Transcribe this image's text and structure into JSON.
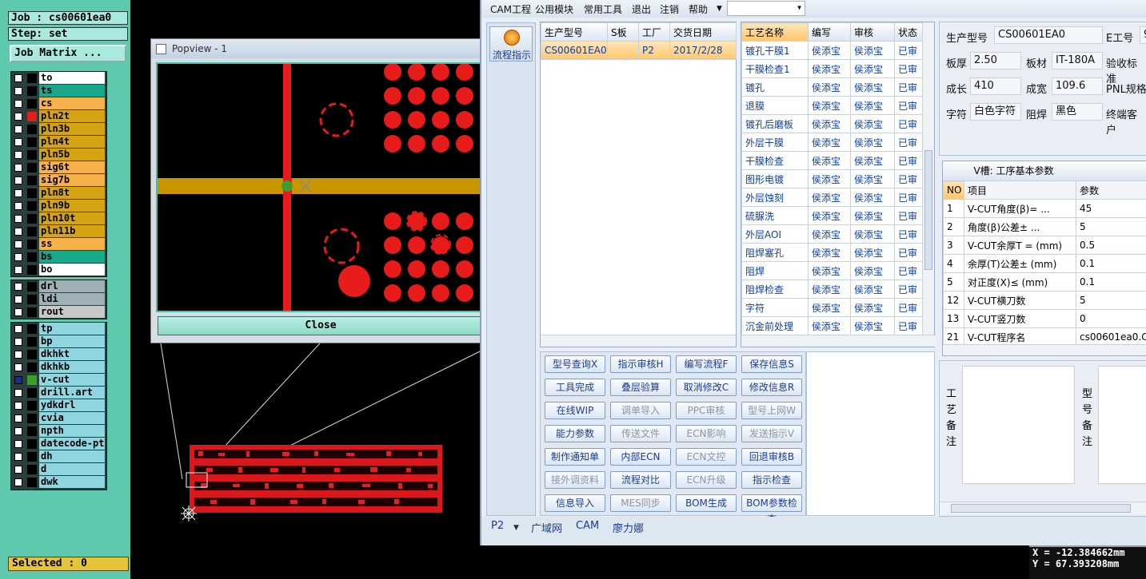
{
  "cam": {
    "job": "Job : cs00601ea0",
    "step": "Step: set",
    "job_matrix": "Job Matrix ...",
    "groups": [
      [
        {
          "name": "to",
          "bg": "#ffffff",
          "sq": "#000000",
          "cb": false
        },
        {
          "name": "ts",
          "bg": "#1aa88a",
          "sq": "#000000",
          "cb": false
        },
        {
          "name": "cs",
          "bg": "#f6b14a",
          "sq": "#000000",
          "cb": false
        },
        {
          "name": "pln2t",
          "bg": "#d4a413",
          "sq": "#e0201d",
          "cb": false
        },
        {
          "name": "pln3b",
          "bg": "#d4a413",
          "sq": "#000000",
          "cb": false
        },
        {
          "name": "pln4t",
          "bg": "#d4a413",
          "sq": "#000000",
          "cb": false
        },
        {
          "name": "pln5b",
          "bg": "#d4a413",
          "sq": "#000000",
          "cb": false
        },
        {
          "name": "sig6t",
          "bg": "#f6b14a",
          "sq": "#000000",
          "cb": false
        },
        {
          "name": "sig7b",
          "bg": "#f6b14a",
          "sq": "#000000",
          "cb": false
        },
        {
          "name": "pln8t",
          "bg": "#d4a413",
          "sq": "#000000",
          "cb": false
        },
        {
          "name": "pln9b",
          "bg": "#d4a413",
          "sq": "#000000",
          "cb": false
        },
        {
          "name": "pln10t",
          "bg": "#d4a413",
          "sq": "#000000",
          "cb": false
        },
        {
          "name": "pln11b",
          "bg": "#d4a413",
          "sq": "#000000",
          "cb": false
        },
        {
          "name": "ss",
          "bg": "#f6b14a",
          "sq": "#000000",
          "cb": false
        },
        {
          "name": "bs",
          "bg": "#1aa88a",
          "sq": "#000000",
          "cb": false
        },
        {
          "name": "bo",
          "bg": "#ffffff",
          "sq": "#000000",
          "cb": false
        }
      ],
      [
        {
          "name": "drl",
          "bg": "#9fb0b6",
          "sq": "#000000",
          "cb": false
        },
        {
          "name": "ldi",
          "bg": "#9fb0b6",
          "sq": "#000000",
          "cb": false
        },
        {
          "name": "rout",
          "bg": "#c8c8c8",
          "sq": "#000000",
          "cb": false
        }
      ],
      [
        {
          "name": "tp",
          "bg": "#8fd6e0",
          "sq": "#000000",
          "cb": false
        },
        {
          "name": "bp",
          "bg": "#8fd6e0",
          "sq": "#000000",
          "cb": false
        },
        {
          "name": "dkhkt",
          "bg": "#8fd6e0",
          "sq": "#000000",
          "cb": false
        },
        {
          "name": "dkhkb",
          "bg": "#8fd6e0",
          "sq": "#000000",
          "cb": false
        },
        {
          "name": "v-cut",
          "bg": "#8fd6e0",
          "sq": "#3aa02a",
          "cb": true
        },
        {
          "name": "drill.art",
          "bg": "#8fd6e0",
          "sq": "#000000",
          "cb": false
        },
        {
          "name": "ydkdrl",
          "bg": "#8fd6e0",
          "sq": "#000000",
          "cb": false
        },
        {
          "name": "cvia",
          "bg": "#8fd6e0",
          "sq": "#000000",
          "cb": false
        },
        {
          "name": "npth",
          "bg": "#8fd6e0",
          "sq": "#000000",
          "cb": false
        },
        {
          "name": "datecode-pte",
          "bg": "#8fd6e0",
          "sq": "#000000",
          "cb": false
        },
        {
          "name": "dh",
          "bg": "#8fd6e0",
          "sq": "#000000",
          "cb": false
        },
        {
          "name": "d",
          "bg": "#8fd6e0",
          "sq": "#000000",
          "cb": false
        },
        {
          "name": "dwk",
          "bg": "#8fd6e0",
          "sq": "#000000",
          "cb": false
        }
      ]
    ],
    "selected": "Selected : 0",
    "coord_x": "X = -12.384662mm",
    "coord_y": "Y = 67.393208mm"
  },
  "popview": {
    "title": "Popview - 1",
    "close": "Close"
  },
  "app": {
    "menu": [
      "CAM工程",
      "公用模块",
      "常用工具",
      "退出",
      "注销",
      "帮助"
    ],
    "side_button": "流程指示",
    "orders": {
      "headers": [
        "生产型号",
        "S板",
        "工厂",
        "交货日期"
      ],
      "rows": [
        [
          "CS00601EA0",
          "",
          "P2",
          "2017/2/28"
        ]
      ]
    },
    "process": {
      "headers": [
        "工艺名称",
        "编写",
        "审核",
        "状态"
      ],
      "rows": [
        [
          "镀孔干膜1",
          "侯添宝",
          "侯添宝",
          "已审"
        ],
        [
          "干膜检查1",
          "侯添宝",
          "侯添宝",
          "已审"
        ],
        [
          "镀孔",
          "侯添宝",
          "侯添宝",
          "已审"
        ],
        [
          "退膜",
          "侯添宝",
          "侯添宝",
          "已审"
        ],
        [
          "镀孔后磨板",
          "侯添宝",
          "侯添宝",
          "已审"
        ],
        [
          "外层干膜",
          "侯添宝",
          "侯添宝",
          "已审"
        ],
        [
          "干膜检查",
          "侯添宝",
          "侯添宝",
          "已审"
        ],
        [
          "图形电镀",
          "侯添宝",
          "侯添宝",
          "已审"
        ],
        [
          "外层蚀刻",
          "侯添宝",
          "侯添宝",
          "已审"
        ],
        [
          "硫脲洗",
          "侯添宝",
          "侯添宝",
          "已审"
        ],
        [
          "外层AOI",
          "侯添宝",
          "侯添宝",
          "已审"
        ],
        [
          "阻焊塞孔",
          "侯添宝",
          "侯添宝",
          "已审"
        ],
        [
          "阻焊",
          "侯添宝",
          "侯添宝",
          "已审"
        ],
        [
          "阻焊检查",
          "侯添宝",
          "侯添宝",
          "已审"
        ],
        [
          "字符",
          "侯添宝",
          "侯添宝",
          "已审"
        ],
        [
          "沉金前处理",
          "侯添宝",
          "侯添宝",
          "已审"
        ]
      ]
    },
    "buttons": [
      [
        {
          "t": "型号查询X",
          "d": false
        },
        {
          "t": "指示审核H",
          "d": false
        },
        {
          "t": "编写流程F",
          "d": false
        },
        {
          "t": "保存信息S",
          "d": false
        }
      ],
      [
        {
          "t": "工具完成",
          "d": false
        },
        {
          "t": "叠层验算",
          "d": false
        },
        {
          "t": "取消修改C",
          "d": false
        },
        {
          "t": "修改信息R",
          "d": false
        }
      ],
      [
        {
          "t": "在线WIP",
          "d": false
        },
        {
          "t": "调单导入",
          "d": true
        },
        {
          "t": "PPC审核",
          "d": true
        },
        {
          "t": "型号上网W",
          "d": true
        }
      ],
      [
        {
          "t": "能力参数",
          "d": false
        },
        {
          "t": "传送文件",
          "d": true
        },
        {
          "t": "ECN影响",
          "d": true
        },
        {
          "t": "发送指示V",
          "d": true
        }
      ],
      [
        {
          "t": "制作通知单",
          "d": false
        },
        {
          "t": "内部ECN",
          "d": false
        },
        {
          "t": "ECN文控",
          "d": true
        },
        {
          "t": "回退审核B",
          "d": false
        }
      ],
      [
        {
          "t": "接外调资料",
          "d": true
        },
        {
          "t": "流程对比",
          "d": false
        },
        {
          "t": "ECN升级",
          "d": true
        },
        {
          "t": "指示检查",
          "d": false
        }
      ],
      [
        {
          "t": "信息导入",
          "d": false
        },
        {
          "t": "MES同步",
          "d": true
        },
        {
          "t": "BOM生成",
          "d": false
        },
        {
          "t": "BOM参数检查",
          "d": false
        }
      ]
    ],
    "info": {
      "r1": {
        "l1": "生产型号",
        "v1": "CS00601EA0",
        "l2": "E工号",
        "v2": "9"
      },
      "r2": {
        "l1": "板厚",
        "v1": "2.50",
        "l2": "板材",
        "v2": "IT-180A",
        "l3": "验收标准"
      },
      "r3": {
        "l1": "成长",
        "v1": "410",
        "l2": "成宽",
        "v2": "109.6",
        "l3": "PNL规格"
      },
      "r4": {
        "l1": "字符",
        "v1": "白色字符",
        "l2": "阻焊",
        "v2": "黑色",
        "l3": "终端客户"
      }
    },
    "vcut": {
      "title": "V槽: 工序基本参数",
      "headers": [
        "NO",
        "项目",
        "参数"
      ],
      "rows": [
        [
          "1",
          "V-CUT角度(β)=  ...",
          "45"
        ],
        [
          "2",
          "角度(β)公差±  ...",
          "5"
        ],
        [
          "3",
          "V-CUT余厚T =  (mm)",
          "0.5"
        ],
        [
          "4",
          "余厚(T)公差±  (mm)",
          "0.1"
        ],
        [
          "5",
          "对正度(X)≤ (mm)",
          "0.1"
        ],
        [
          "12",
          "V-CUT横刀数",
          "5"
        ],
        [
          "13",
          "V-CUT竖刀数",
          "0"
        ],
        [
          "21",
          "V-CUT程序名",
          "cs00601ea0.C"
        ]
      ]
    },
    "note1": "工艺备注",
    "note2": "型号备注",
    "tabs": [
      "P2",
      "广域网",
      "CAM",
      "廖力娜"
    ]
  }
}
